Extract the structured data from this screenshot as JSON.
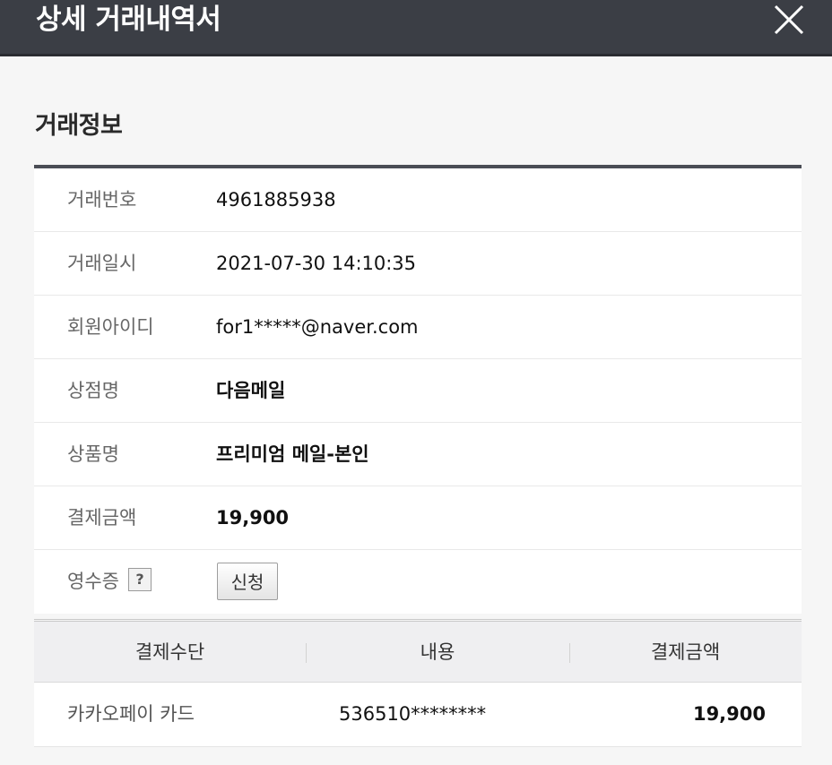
{
  "window": {
    "title": "상세 거래내역서",
    "close_icon": "close-icon"
  },
  "section": {
    "title": "거래정보"
  },
  "info": {
    "rows": [
      {
        "label": "거래번호",
        "value": "4961885938"
      },
      {
        "label": "거래일시",
        "value": "2021-07-30 14:10:35"
      },
      {
        "label": "회원아이디",
        "value": "for1*****@naver.com"
      },
      {
        "label": "상점명",
        "value": "다음메일"
      },
      {
        "label": "상품명",
        "value": "프리미엄 메일-본인"
      },
      {
        "label": "결제금액",
        "value": "19,900"
      }
    ],
    "receipt": {
      "label": "영수증",
      "help": "?",
      "button_label": "신청"
    }
  },
  "payment": {
    "headers": [
      "결제수단",
      "내용",
      "결제금액"
    ],
    "rows": [
      {
        "method": "카카오페이 카드",
        "detail": "536510********",
        "amount": "19,900"
      }
    ]
  }
}
